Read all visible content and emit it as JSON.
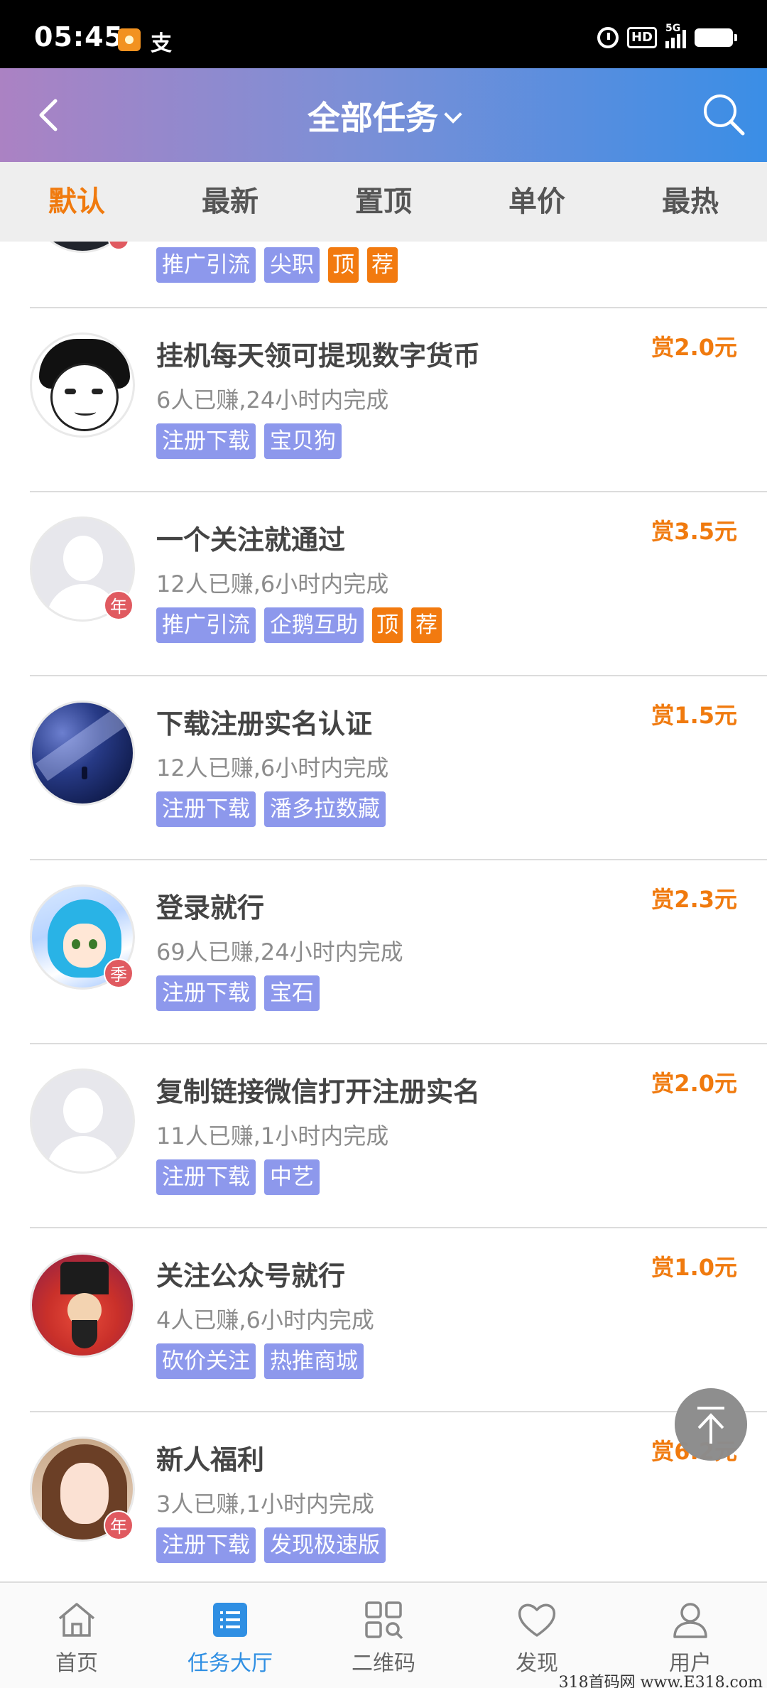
{
  "status_bar": {
    "time": "05:45",
    "app_icon_2": "支",
    "hd_label": "HD",
    "network": "5G"
  },
  "header": {
    "title": "全部任务"
  },
  "tabs": [
    {
      "label": "默认",
      "active": true
    },
    {
      "label": "最新"
    },
    {
      "label": "置顶"
    },
    {
      "label": "单价"
    },
    {
      "label": "最热"
    }
  ],
  "tasks": [
    {
      "title": "",
      "meta": "",
      "reward": "",
      "badge": "",
      "avatar": "partial",
      "tags": [
        "推广引流",
        "尖职"
      ],
      "flags": [
        "顶",
        "荐"
      ]
    },
    {
      "title": "挂机每天领可提现数字货币",
      "meta": "6人已赚,24小时内完成",
      "reward": "赏2.0元",
      "badge": "",
      "avatar": "meme",
      "tags": [
        "注册下载",
        "宝贝狗"
      ],
      "flags": []
    },
    {
      "title": "一个关注就通过",
      "meta": "12人已赚,6小时内完成",
      "reward": "赏3.5元",
      "badge": "年",
      "avatar": "default",
      "tags": [
        "推广引流",
        "企鹅互助"
      ],
      "flags": [
        "顶",
        "荐"
      ]
    },
    {
      "title": "下载注册实名认证",
      "meta": "12人已赚,6小时内完成",
      "reward": "赏1.5元",
      "badge": "",
      "avatar": "space",
      "tags": [
        "注册下载",
        "潘多拉数藏"
      ],
      "flags": []
    },
    {
      "title": "登录就行",
      "meta": "69人已赚,24小时内完成",
      "reward": "赏2.3元",
      "badge": "季",
      "avatar": "anime",
      "tags": [
        "注册下载",
        "宝石"
      ],
      "flags": []
    },
    {
      "title": "复制链接微信打开注册实名",
      "meta": "11人已赚,1小时内完成",
      "reward": "赏2.0元",
      "badge": "",
      "avatar": "default",
      "tags": [
        "注册下载",
        "中艺"
      ],
      "flags": []
    },
    {
      "title": "关注公众号就行",
      "meta": "4人已赚,6小时内完成",
      "reward": "赏1.0元",
      "badge": "",
      "avatar": "god",
      "tags": [
        "砍价关注",
        "热推商城"
      ],
      "flags": []
    },
    {
      "title": "新人福利",
      "meta": "3人已赚,1小时内完成",
      "reward": "赏6.2元",
      "badge": "年",
      "avatar": "girl",
      "tags": [
        "注册下载",
        "发现极速版"
      ],
      "flags": []
    }
  ],
  "bottom_nav": [
    {
      "label": "首页",
      "icon": "home-icon"
    },
    {
      "label": "任务大厅",
      "icon": "task-list-icon",
      "active": true
    },
    {
      "label": "二维码",
      "icon": "qrcode-icon"
    },
    {
      "label": "发现",
      "icon": "heart-icon"
    },
    {
      "label": "用户",
      "icon": "user-icon"
    }
  ],
  "watermark": "318首码网  www.E318.com",
  "colors": {
    "accent": "#f07a0e",
    "tag": "#8d98ec",
    "flag": "#f27a0f",
    "nav_active": "#2f8fe3"
  }
}
